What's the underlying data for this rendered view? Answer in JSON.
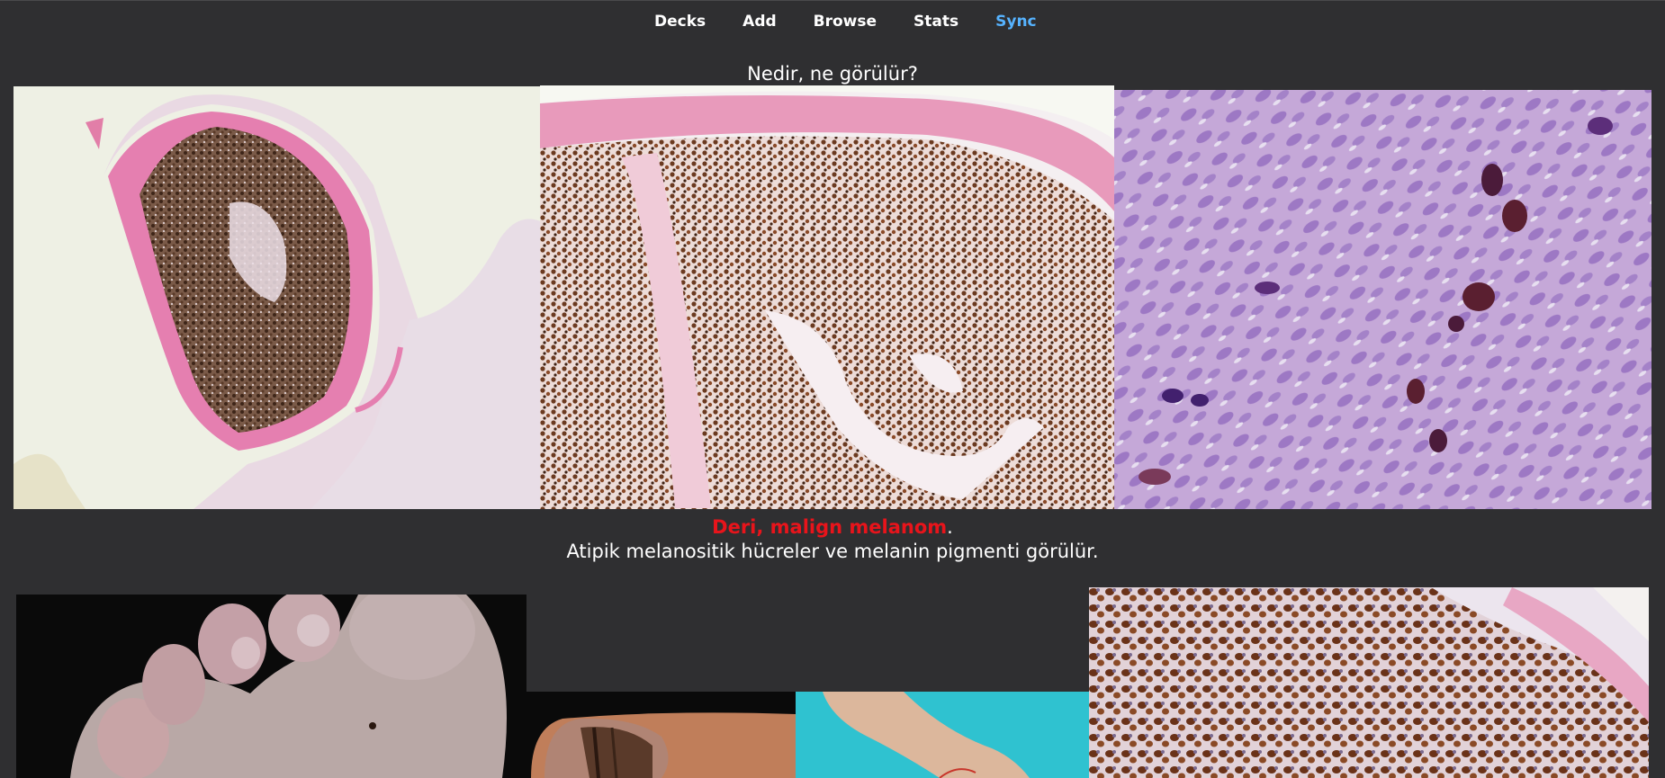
{
  "nav": {
    "decks": "Decks",
    "add": "Add",
    "browse": "Browse",
    "stats": "Stats",
    "sync": "Sync",
    "sync_color": "#56b3ff"
  },
  "card": {
    "question": "Nedir, ne görülür?",
    "answer_highlight": "Deri, malign melanom",
    "answer_punct": ".",
    "answer_detail": "Atipik melanositik hücreler ve melanin pigmenti görülür.",
    "highlight_color": "#e8141b"
  },
  "images": [
    {
      "name": "histology-low-power-image"
    },
    {
      "name": "histology-medium-power-image"
    },
    {
      "name": "histology-high-power-image"
    },
    {
      "name": "clinical-foot-image"
    },
    {
      "name": "clinical-nail-image"
    },
    {
      "name": "clinical-leg-image"
    },
    {
      "name": "histology-pigmented-cells-image"
    }
  ]
}
